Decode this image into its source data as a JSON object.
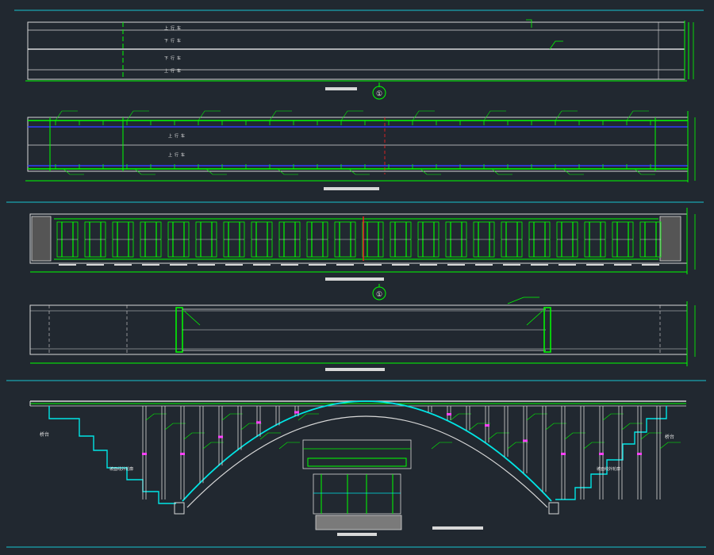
{
  "colors": {
    "background": "#212830",
    "separator": "#18c4cf",
    "primary": "#00ff00",
    "light": "#d8d8d8",
    "highlight": "#ffffff",
    "accent_blue": "#2f3cff",
    "accent_red": "#ff2020",
    "accent_magenta": "#ff40ff",
    "cyan": "#00e5e5"
  },
  "labels": {
    "section_mark_1": "①",
    "section_mark_2": "①",
    "left_bank": "桥台",
    "right_bank": "桥台",
    "left_slope_note": "坡面线外轮廓",
    "right_slope_note": "坡面线外轮廓",
    "lane_1": "上 行 车",
    "lane_2": "下 行 车",
    "lane_3": "下 行 车",
    "lane_4": "上 行 车"
  },
  "drawing": {
    "panels": [
      {
        "id": "deck-plan"
      },
      {
        "id": "beam-plan"
      },
      {
        "id": "girder-elevation"
      },
      {
        "id": "girder-side"
      },
      {
        "id": "arch-elevation"
      }
    ]
  }
}
